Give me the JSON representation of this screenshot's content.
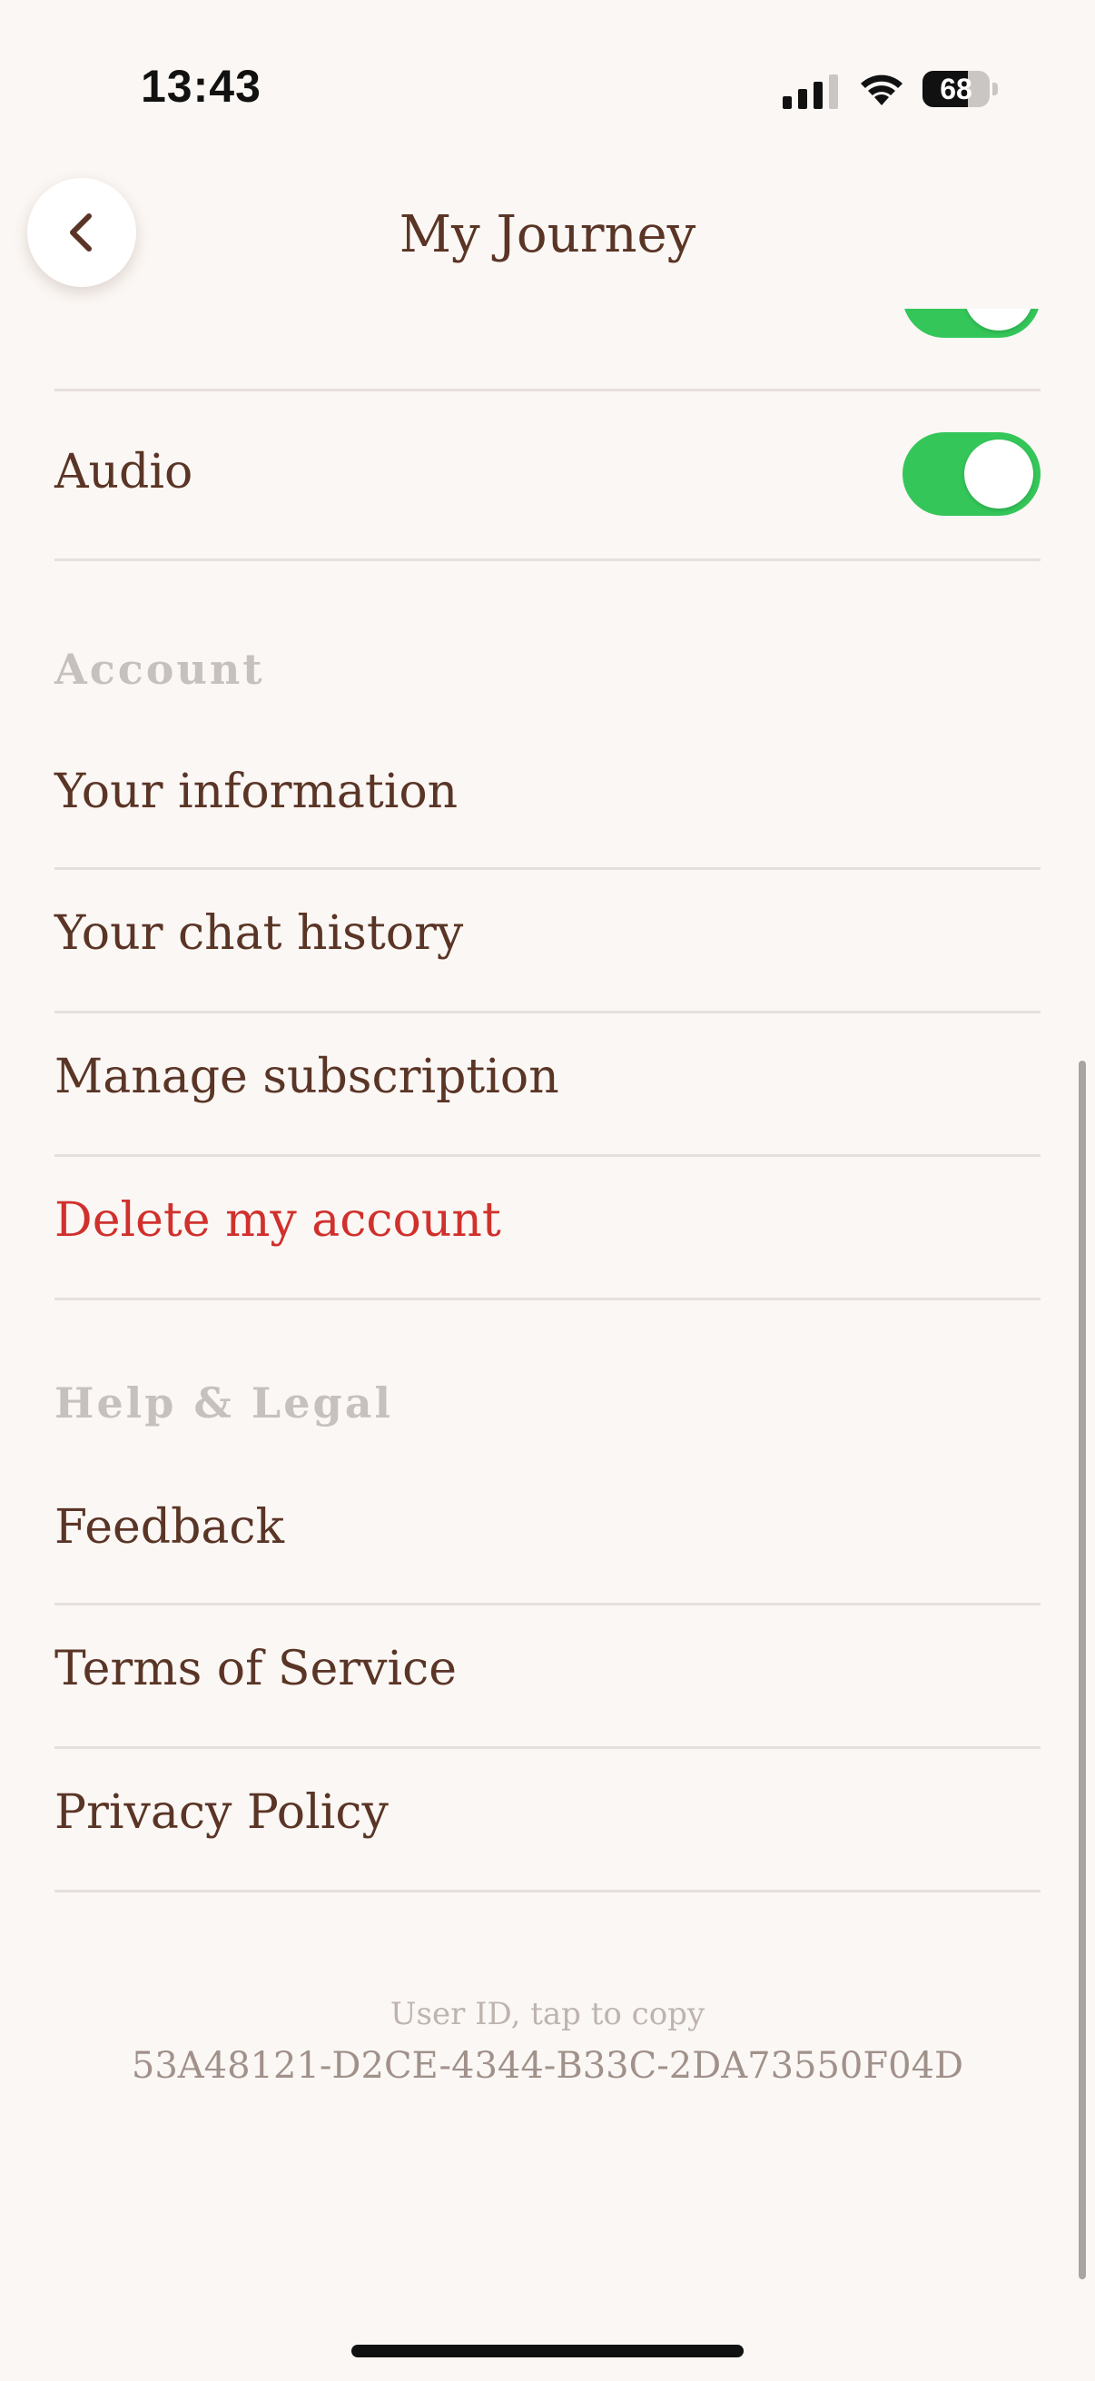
{
  "status_bar": {
    "time": "13:43",
    "battery_level": "68",
    "battery_fraction": 0.68
  },
  "header": {
    "title": "My Journey",
    "back_icon": "chevron-left-icon"
  },
  "toggles": [
    {
      "label": "",
      "on": true
    },
    {
      "label": "Audio",
      "on": true
    }
  ],
  "colors": {
    "background": "#FBF7F4",
    "text": "#5A3526",
    "danger": "#D0312D",
    "toggle_on": "#34C659",
    "section_header": "#C6C1BE"
  },
  "account": {
    "header": "Account",
    "items": [
      {
        "label": "Your information"
      },
      {
        "label": "Your chat history"
      },
      {
        "label": "Manage subscription"
      },
      {
        "label": "Delete my account"
      }
    ]
  },
  "help_legal": {
    "header": "Help & Legal",
    "items": [
      {
        "label": "Feedback"
      },
      {
        "label": "Terms of Service"
      },
      {
        "label": "Privacy Policy"
      }
    ]
  },
  "footer": {
    "caption": "User ID, tap to copy",
    "user_id": "53A48121-D2CE-4344-B33C-2DA73550F04D"
  }
}
